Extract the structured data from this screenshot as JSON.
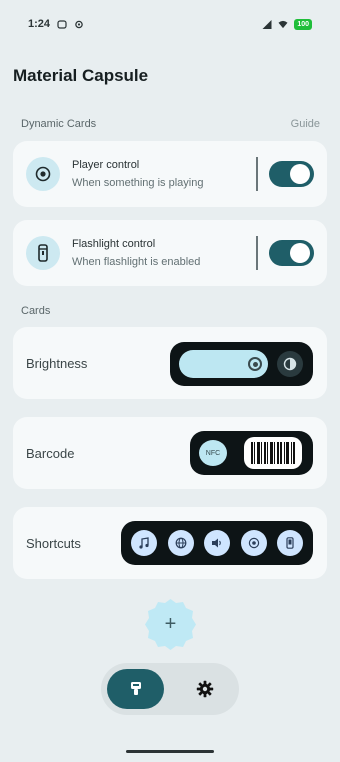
{
  "status_bar": {
    "time": "1:24",
    "icons_left": [
      "notification-icon",
      "settings-small-icon"
    ],
    "icons_right": [
      "signal-icon",
      "wifi-icon"
    ],
    "battery": "100"
  },
  "app": {
    "title": "Material Capsule"
  },
  "dynamic_cards": {
    "section_label": "Dynamic Cards",
    "guide_label": "Guide",
    "items": [
      {
        "title": "Player control",
        "subtitle": "When something is playing",
        "icon": "play-circle-icon",
        "enabled": true
      },
      {
        "title": "Flashlight control",
        "subtitle": "When flashlight is enabled",
        "icon": "flashlight-icon",
        "enabled": true
      }
    ]
  },
  "cards": {
    "section_label": "Cards",
    "items": [
      {
        "label": "Brightness"
      },
      {
        "label": "Barcode",
        "nfc_label": "NFC"
      },
      {
        "label": "Shortcuts",
        "shortcut_icons": [
          "music-icon",
          "globe-icon",
          "volume-icon",
          "target-icon",
          "phone-icon"
        ]
      }
    ]
  },
  "fab": {
    "label": "+"
  },
  "bottom_nav": {
    "items": [
      {
        "icon": "capsule-icon",
        "active": true
      },
      {
        "icon": "gear-icon",
        "active": false
      }
    ]
  },
  "colors": {
    "background": "#e8eef0",
    "card": "#f6f9fa",
    "accent": "#1f5e68",
    "capsule": "#0d1416",
    "light_accent": "#bde7f2"
  }
}
